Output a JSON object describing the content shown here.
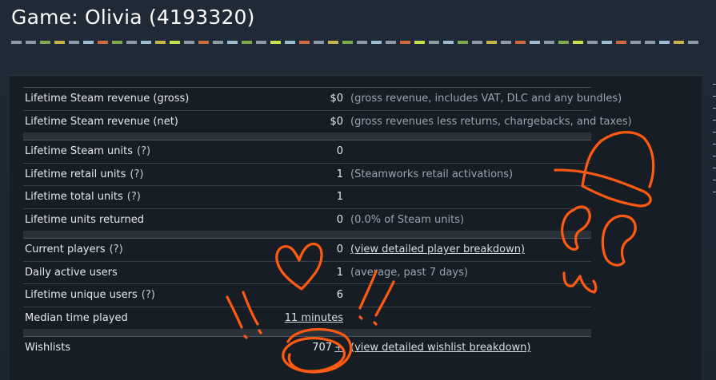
{
  "header": {
    "title": "Game: Olivia (4193320)",
    "stripe_colors": [
      "#8c9aa6",
      "#8c9aa6",
      "#7ea84c",
      "#c9b24a",
      "#8c9aa6",
      "#9ebbd0",
      "#d06a3a",
      "#7ea84c",
      "#8c9aa6",
      "#9ebbd0",
      "#c9b24a",
      "#c7e04c",
      "#8c9aa6",
      "#d06a3a",
      "#8c9aa6",
      "#9ebbd0",
      "#7ea84c",
      "#8c9aa6",
      "#c7e04c",
      "#9ebbd0",
      "#d06a3a",
      "#8c9aa6",
      "#c9b24a",
      "#7ea84c",
      "#8c9aa6",
      "#9ebbd0",
      "#8c9aa6",
      "#d06a3a",
      "#c7e04c",
      "#8c9aa6",
      "#9ebbd0",
      "#7ea84c",
      "#8c9aa6",
      "#c9b24a",
      "#8c9aa6",
      "#d06a3a",
      "#9ebbd0",
      "#8c9aa6",
      "#7ea84c",
      "#c7e04c",
      "#8c9aa6",
      "#9ebbd0",
      "#d06a3a",
      "#8c9aa6",
      "#8c9aa6",
      "#9ebbd0",
      "#c9b24a",
      "#8c9aa6"
    ]
  },
  "stats": {
    "revenue_gross": {
      "label": "Lifetime Steam revenue (gross)",
      "value": "$0",
      "note": "(gross revenue, includes VAT, DLC and any bundles)"
    },
    "revenue_net": {
      "label": "Lifetime Steam revenue (net)",
      "value": "$0",
      "note": "(gross revenues less returns, chargebacks, and taxes)"
    },
    "steam_units": {
      "label": "Lifetime Steam units",
      "help": "(?)",
      "value": "0"
    },
    "retail_units": {
      "label": "Lifetime retail units",
      "help": "(?)",
      "value": "1",
      "note": "(Steamworks retail activations)"
    },
    "total_units": {
      "label": "Lifetime total units",
      "help": "(?)",
      "value": "1"
    },
    "units_returned": {
      "label": "Lifetime units returned",
      "value": "0",
      "note": "(0.0% of Steam units)"
    },
    "current_players": {
      "label": "Current players",
      "help": "(?)",
      "value": "0",
      "link": "(view detailed player breakdown)"
    },
    "daily_active": {
      "label": "Daily active users",
      "value": "1",
      "note": "(average, past 7 days)"
    },
    "unique_users": {
      "label": "Lifetime unique users",
      "help": "(?)",
      "value": "6"
    },
    "median_time": {
      "label": "Median time played",
      "value": "11 minutes"
    },
    "wishlists": {
      "label": "Wishlists",
      "value": "707",
      "plus": "+",
      "link": "(view detailed wishlist breakdown)"
    }
  }
}
